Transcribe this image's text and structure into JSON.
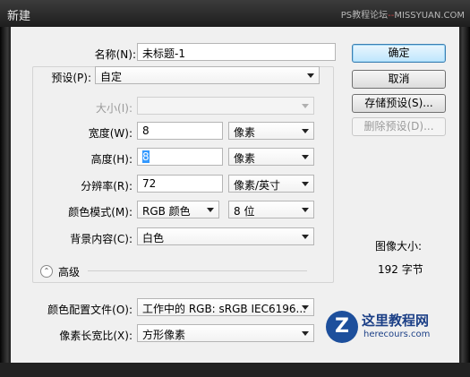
{
  "window": {
    "title": "新建",
    "watermark_left": "PS教程论坛",
    "watermark_sep": "--",
    "watermark_right": "MISSYUAN.COM"
  },
  "form": {
    "name_label": "名称(N):",
    "name_value": "未标题-1",
    "preset_label": "预设(P):",
    "preset_value": "自定",
    "size_label": "大小(I):",
    "size_value": "",
    "width_label": "宽度(W):",
    "width_value": "8",
    "width_unit": "像素",
    "height_label": "高度(H):",
    "height_value": "8",
    "height_unit": "像素",
    "resolution_label": "分辨率(R):",
    "resolution_value": "72",
    "resolution_unit": "像素/英寸",
    "colormode_label": "颜色模式(M):",
    "colormode_value": "RGB 颜色",
    "bitdepth_value": "8 位",
    "background_label": "背景内容(C):",
    "background_value": "白色",
    "advanced_label": "高级",
    "advanced_toggle_glyph": "⌃",
    "profile_label": "颜色配置文件(O):",
    "profile_value": "工作中的 RGB: sRGB IEC6196...",
    "pixelaspect_label": "像素长宽比(X):",
    "pixelaspect_value": "方形像素"
  },
  "buttons": {
    "ok": "确定",
    "cancel": "取消",
    "save_preset": "存储预设(S)...",
    "delete_preset": "删除预设(D)..."
  },
  "image_size": {
    "label": "图像大小:",
    "value": "192 字节"
  },
  "logo": {
    "mark": "Z",
    "title": "这里教程网",
    "url": "herecours.com"
  },
  "colors": {
    "accent": "#3399ff",
    "default_button": "#bee6fd",
    "titlebar": "#2a2a2a"
  }
}
